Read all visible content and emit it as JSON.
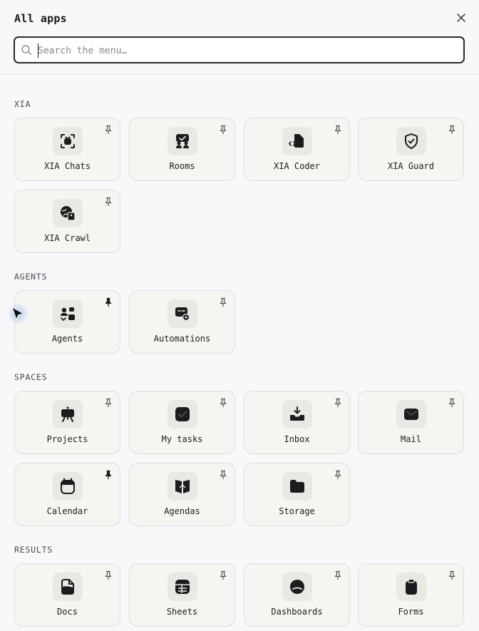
{
  "header": {
    "title": "All apps",
    "close_icon": "close-icon"
  },
  "search": {
    "placeholder": "Search the menu…",
    "value": "",
    "icon": "search-icon"
  },
  "sections": [
    {
      "label": "XIA",
      "apps": [
        {
          "label": "XIA Chats",
          "icon": "chat-bot-icon",
          "pinned": false
        },
        {
          "label": "Rooms",
          "icon": "rooms-icon",
          "pinned": false
        },
        {
          "label": "XIA Coder",
          "icon": "code-file-icon",
          "pinned": false
        },
        {
          "label": "XIA Guard",
          "icon": "shield-check-icon",
          "pinned": false
        },
        {
          "label": "XIA Crawl",
          "icon": "crawl-globe-icon",
          "pinned": false
        }
      ]
    },
    {
      "label": "AGENTS",
      "apps": [
        {
          "label": "Agents",
          "icon": "agents-icon",
          "pinned": true
        },
        {
          "label": "Automations",
          "icon": "automation-gear-icon",
          "pinned": false
        }
      ]
    },
    {
      "label": "SPACES",
      "apps": [
        {
          "label": "Projects",
          "icon": "presentation-board-icon",
          "pinned": false
        },
        {
          "label": "My tasks",
          "icon": "check-square-icon",
          "pinned": false
        },
        {
          "label": "Inbox",
          "icon": "inbox-tray-icon",
          "pinned": false
        },
        {
          "label": "Mail",
          "icon": "mail-envelope-icon",
          "pinned": false
        },
        {
          "label": "Calendar",
          "icon": "calendar-icon",
          "pinned": true
        },
        {
          "label": "Agendas",
          "icon": "agenda-book-icon",
          "pinned": false
        },
        {
          "label": "Storage",
          "icon": "folder-icon",
          "pinned": false
        }
      ]
    },
    {
      "label": "RESULTS",
      "apps": [
        {
          "label": "Docs",
          "icon": "document-icon",
          "pinned": false
        },
        {
          "label": "Sheets",
          "icon": "spreadsheet-icon",
          "pinned": false
        },
        {
          "label": "Dashboards",
          "icon": "dashboard-gauge-icon",
          "pinned": false
        },
        {
          "label": "Forms",
          "icon": "clipboard-form-icon",
          "pinned": false
        }
      ]
    }
  ]
}
